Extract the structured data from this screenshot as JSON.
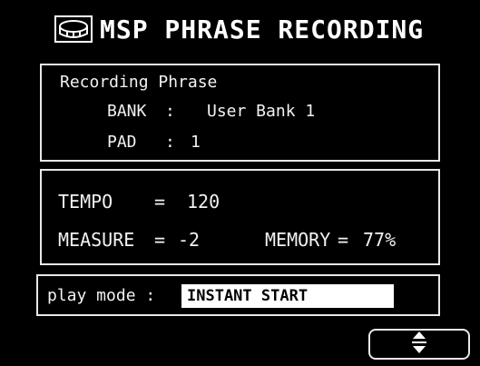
{
  "title": {
    "text": "MSP PHRASE RECORDING",
    "icon": "msp-drum-icon"
  },
  "recording": {
    "heading": "Recording Phrase",
    "bank_label": "BANK",
    "bank_colon": ":",
    "bank_value": "User Bank 1",
    "pad_label": "PAD",
    "pad_colon": ":",
    "pad_value": "1"
  },
  "tempo_panel": {
    "tempo_label": "TEMPO",
    "tempo_eq": "=",
    "tempo_value": "120",
    "measure_label": "MEASURE",
    "measure_eq": "=",
    "measure_value": "-2",
    "memory_label": "MEMORY",
    "memory_eq": "=",
    "memory_value": "77%"
  },
  "play_mode": {
    "label": "play mode :",
    "value": "INSTANT START"
  },
  "scroll_button": {
    "icon": "up-down-arrow-icon"
  }
}
